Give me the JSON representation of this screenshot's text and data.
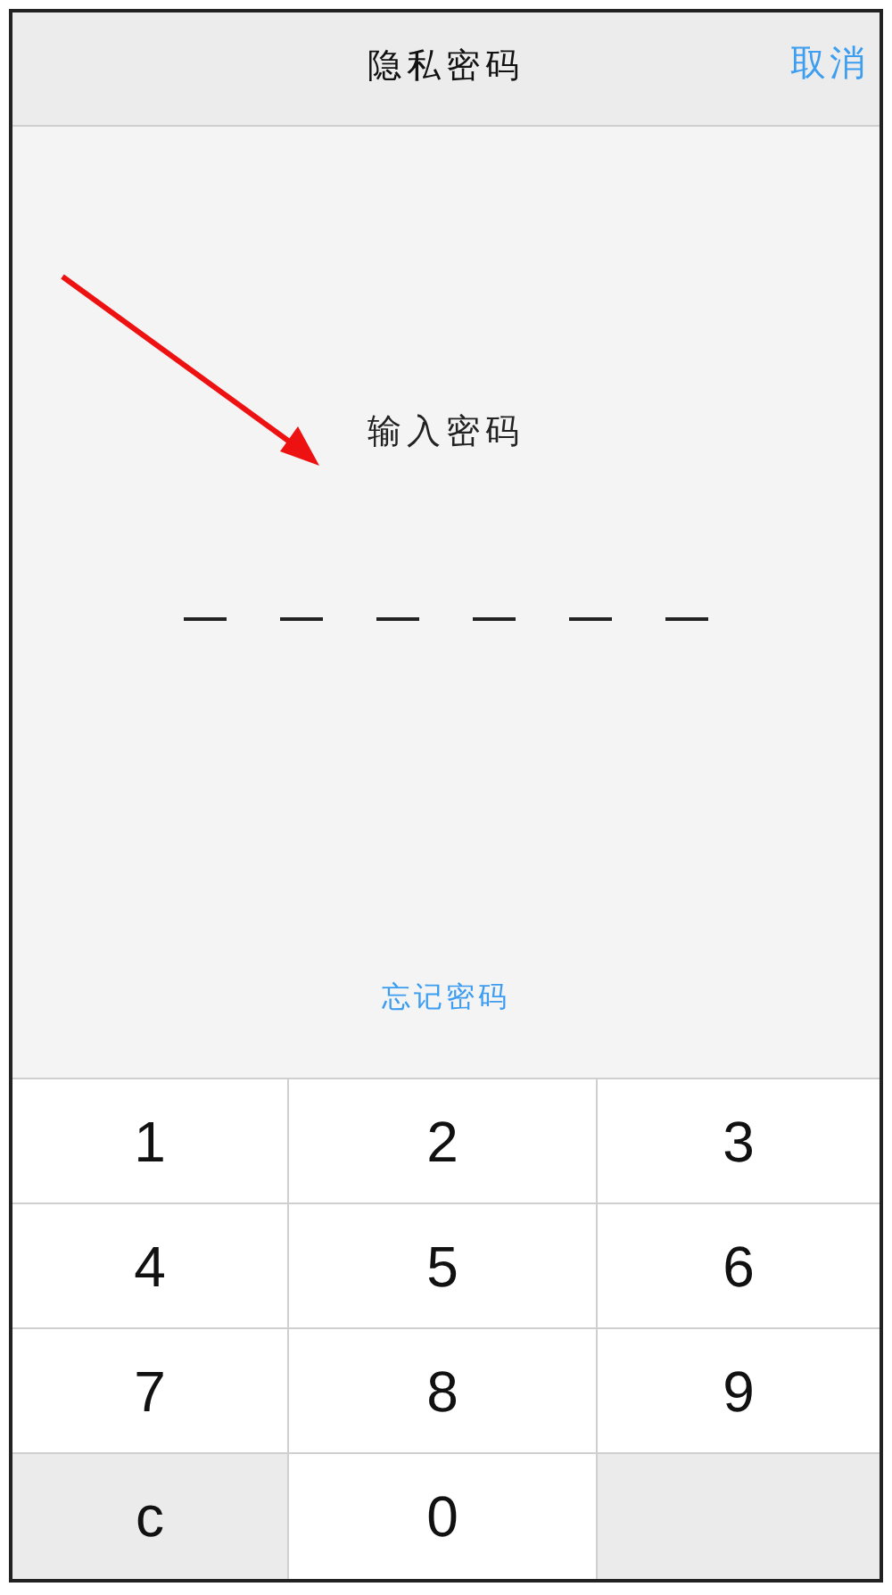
{
  "header": {
    "title": "隐私密码",
    "cancel": "取消"
  },
  "prompt": "输入密码",
  "slots": [
    {
      "filled": false
    },
    {
      "filled": false
    },
    {
      "filled": false
    },
    {
      "filled": false
    },
    {
      "filled": false
    },
    {
      "filled": false
    }
  ],
  "forgot_link": "忘记密码",
  "keys": [
    {
      "kind": "digit",
      "label": "1"
    },
    {
      "kind": "digit",
      "label": "2"
    },
    {
      "kind": "digit",
      "label": "3"
    },
    {
      "kind": "digit",
      "label": "4"
    },
    {
      "kind": "digit",
      "label": "5"
    },
    {
      "kind": "digit",
      "label": "6"
    },
    {
      "kind": "digit",
      "label": "7"
    },
    {
      "kind": "digit",
      "label": "8"
    },
    {
      "kind": "digit",
      "label": "9"
    },
    {
      "kind": "clear",
      "label": "c"
    },
    {
      "kind": "digit",
      "label": "0"
    },
    {
      "kind": "blank"
    }
  ]
}
